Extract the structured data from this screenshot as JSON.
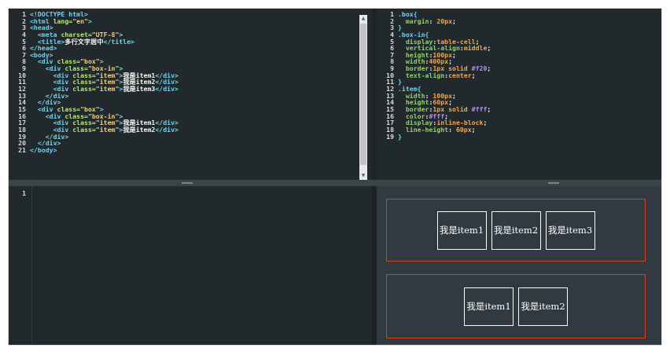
{
  "html_editor": {
    "line_numbers": [
      "1",
      "2",
      "3",
      "4",
      "5",
      "6",
      "7",
      "8",
      "9",
      "10",
      "11",
      "12",
      "13",
      "14",
      "15",
      "16",
      "17",
      "18",
      "19",
      "20",
      "21"
    ],
    "lines": [
      [
        [
          "tag",
          "<!DOCTYPE html>"
        ]
      ],
      [
        [
          "tag",
          "<html "
        ],
        [
          "attr",
          "lang="
        ],
        [
          "val",
          "\"en\""
        ],
        [
          "tag",
          ">"
        ]
      ],
      [
        [
          "tag",
          "<head>"
        ]
      ],
      [
        [
          "t",
          "  "
        ],
        [
          "tag",
          "<meta "
        ],
        [
          "attr",
          "charset="
        ],
        [
          "val",
          "\"UTF-8\""
        ],
        [
          "tag",
          ">"
        ]
      ],
      [
        [
          "t",
          "  "
        ],
        [
          "tag",
          "<title>"
        ],
        [
          "t",
          "多行文字居中"
        ],
        [
          "tag",
          "</title>"
        ]
      ],
      [
        [
          "tag",
          "</head>"
        ]
      ],
      [
        [
          "tag",
          "<body>"
        ]
      ],
      [
        [
          "t",
          "  "
        ],
        [
          "tag",
          "<div "
        ],
        [
          "attr",
          "class="
        ],
        [
          "val",
          "\"box\""
        ],
        [
          "tag",
          ">"
        ]
      ],
      [
        [
          "t",
          "    "
        ],
        [
          "tag",
          "<div "
        ],
        [
          "attr",
          "class="
        ],
        [
          "val",
          "\"box-in\""
        ],
        [
          "tag",
          ">"
        ]
      ],
      [
        [
          "t",
          "      "
        ],
        [
          "tag",
          "<div "
        ],
        [
          "attr",
          "class="
        ],
        [
          "val",
          "\"item\""
        ],
        [
          "tag",
          ">"
        ],
        [
          "t",
          "我是item1"
        ],
        [
          "tag",
          "</div>"
        ]
      ],
      [
        [
          "t",
          "      "
        ],
        [
          "tag",
          "<div "
        ],
        [
          "attr",
          "class="
        ],
        [
          "val",
          "\"item\""
        ],
        [
          "tag",
          ">"
        ],
        [
          "t",
          "我是item2"
        ],
        [
          "tag",
          "</div>"
        ]
      ],
      [
        [
          "t",
          "      "
        ],
        [
          "tag",
          "<div "
        ],
        [
          "attr",
          "class="
        ],
        [
          "val",
          "\"item\""
        ],
        [
          "tag",
          ">"
        ],
        [
          "t",
          "我是item3"
        ],
        [
          "tag",
          "</div>"
        ]
      ],
      [
        [
          "t",
          "    "
        ],
        [
          "tag",
          "</div>"
        ]
      ],
      [
        [
          "t",
          "  "
        ],
        [
          "tag",
          "</div>"
        ]
      ],
      [
        [
          "t",
          "  "
        ],
        [
          "tag",
          "<div "
        ],
        [
          "attr",
          "class="
        ],
        [
          "val",
          "\"box\""
        ],
        [
          "tag",
          ">"
        ]
      ],
      [
        [
          "t",
          "    "
        ],
        [
          "tag",
          "<div "
        ],
        [
          "attr",
          "class="
        ],
        [
          "val",
          "\"box-in\""
        ],
        [
          "tag",
          ">"
        ]
      ],
      [
        [
          "t",
          "      "
        ],
        [
          "tag",
          "<div "
        ],
        [
          "attr",
          "class="
        ],
        [
          "val",
          "\"item\""
        ],
        [
          "tag",
          ">"
        ],
        [
          "t",
          "我是item1"
        ],
        [
          "tag",
          "</div>"
        ]
      ],
      [
        [
          "t",
          "      "
        ],
        [
          "tag",
          "<div "
        ],
        [
          "attr",
          "class="
        ],
        [
          "val",
          "\"item\""
        ],
        [
          "tag",
          ">"
        ],
        [
          "t",
          "我是item2"
        ],
        [
          "tag",
          "</div>"
        ]
      ],
      [
        [
          "t",
          "    "
        ],
        [
          "tag",
          "</div>"
        ]
      ],
      [
        [
          "t",
          "  "
        ],
        [
          "tag",
          "</div>"
        ]
      ],
      [
        [
          "tag",
          "</body>"
        ]
      ]
    ]
  },
  "css_editor": {
    "line_numbers": [
      "1",
      "2",
      "3",
      "4",
      "5",
      "6",
      "7",
      "8",
      "9",
      "10",
      "11",
      "12",
      "13",
      "14",
      "15",
      "16",
      "17",
      "18",
      "19"
    ],
    "lines": [
      [
        [
          "sel",
          ".box{"
        ]
      ],
      [
        [
          "t",
          "  "
        ],
        [
          "prop",
          "margin"
        ],
        [
          "t",
          ": "
        ],
        [
          "pv",
          "20px"
        ],
        [
          "t",
          ";"
        ]
      ],
      [
        [
          "sel",
          "}"
        ]
      ],
      [
        [
          "sel",
          ".box-in{"
        ]
      ],
      [
        [
          "t",
          "  "
        ],
        [
          "prop",
          "display"
        ],
        [
          "t",
          ":"
        ],
        [
          "pv",
          "table-cell"
        ],
        [
          "t",
          ";"
        ]
      ],
      [
        [
          "t",
          "  "
        ],
        [
          "prop",
          "vertical-align"
        ],
        [
          "t",
          ":"
        ],
        [
          "pv",
          "middle"
        ],
        [
          "t",
          ";"
        ]
      ],
      [
        [
          "t",
          "  "
        ],
        [
          "prop",
          "height"
        ],
        [
          "t",
          ":"
        ],
        [
          "pv",
          "100px"
        ],
        [
          "t",
          ";"
        ]
      ],
      [
        [
          "t",
          "  "
        ],
        [
          "prop",
          "width"
        ],
        [
          "t",
          ":"
        ],
        [
          "pv",
          "400px"
        ],
        [
          "t",
          ";"
        ]
      ],
      [
        [
          "t",
          "  "
        ],
        [
          "prop",
          "border"
        ],
        [
          "t",
          ":"
        ],
        [
          "pv",
          "1px solid "
        ],
        [
          "hex",
          "#f20"
        ],
        [
          "t",
          ";"
        ]
      ],
      [
        [
          "t",
          "  "
        ],
        [
          "prop",
          "text-align"
        ],
        [
          "t",
          ":"
        ],
        [
          "pv",
          "center"
        ],
        [
          "t",
          ";"
        ]
      ],
      [
        [
          "sel",
          "}"
        ]
      ],
      [
        [
          "sel",
          ".item{"
        ]
      ],
      [
        [
          "t",
          "  "
        ],
        [
          "prop",
          "width"
        ],
        [
          "t",
          ": "
        ],
        [
          "pv",
          "100px"
        ],
        [
          "t",
          ";"
        ]
      ],
      [
        [
          "t",
          "  "
        ],
        [
          "prop",
          "height"
        ],
        [
          "t",
          ":"
        ],
        [
          "pv",
          "60px"
        ],
        [
          "t",
          ";"
        ]
      ],
      [
        [
          "t",
          "  "
        ],
        [
          "prop",
          "border"
        ],
        [
          "t",
          ":"
        ],
        [
          "pv",
          "1px solid "
        ],
        [
          "hex",
          "#fff"
        ],
        [
          "t",
          ";"
        ]
      ],
      [
        [
          "t",
          "  "
        ],
        [
          "prop",
          "color"
        ],
        [
          "t",
          ":"
        ],
        [
          "hex",
          "#fff"
        ],
        [
          "t",
          ";"
        ]
      ],
      [
        [
          "t",
          "  "
        ],
        [
          "prop",
          "display"
        ],
        [
          "t",
          ":"
        ],
        [
          "pv",
          "inline-block"
        ],
        [
          "t",
          ";"
        ]
      ],
      [
        [
          "t",
          "  "
        ],
        [
          "prop",
          "line-height"
        ],
        [
          "t",
          ": "
        ],
        [
          "pv",
          "60px"
        ],
        [
          "t",
          ";"
        ]
      ],
      [
        [
          "sel",
          "}"
        ]
      ]
    ]
  },
  "js_editor": {
    "line_numbers": [
      "1"
    ]
  },
  "preview": {
    "box1_items": [
      "我是item1",
      "我是item2",
      "我是item3"
    ],
    "box2_items": [
      "我是item1",
      "我是item2"
    ]
  },
  "colors": {
    "editor_bg": "#22292d",
    "preview_bg": "#303a40",
    "box_border": "#d5431d",
    "item_border": "#ffffff"
  },
  "icons": {
    "scroll_up": "▲",
    "scroll_down": "▼"
  }
}
